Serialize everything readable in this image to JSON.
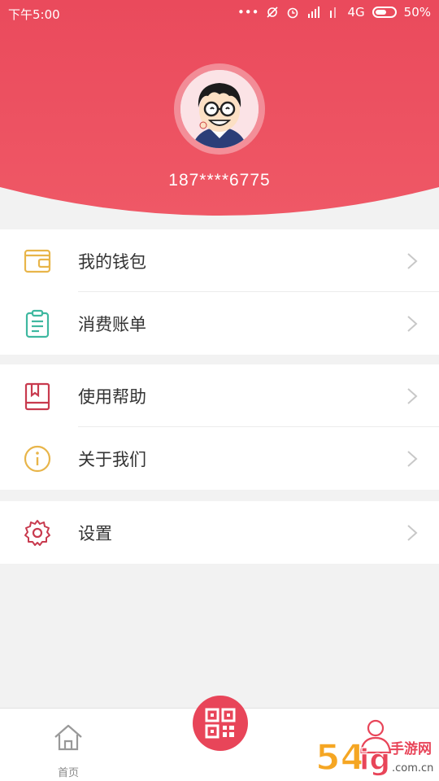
{
  "status_bar": {
    "time": "下午5:00",
    "network": "4G",
    "battery": "50%"
  },
  "profile": {
    "phone": "187****6775"
  },
  "menu": {
    "group1": [
      {
        "label": "我的钱包",
        "icon": "wallet-icon"
      },
      {
        "label": "消费账单",
        "icon": "bill-icon"
      }
    ],
    "group2": [
      {
        "label": "使用帮助",
        "icon": "help-book-icon"
      },
      {
        "label": "关于我们",
        "icon": "info-icon"
      }
    ],
    "group3": [
      {
        "label": "设置",
        "icon": "gear-icon"
      }
    ]
  },
  "tabbar": {
    "home_label": "首页",
    "scan_icon": "qr-code-icon",
    "me_icon": "user-icon"
  },
  "watermark": {
    "brand": "54ig手游网",
    "domain": ".com.cn"
  },
  "colors": {
    "brand_red": "#e84559",
    "wallet": "#e8b54a",
    "bill": "#3fb8a0",
    "help": "#c83a4e",
    "info": "#e8b54a",
    "gear": "#c83a4e"
  }
}
